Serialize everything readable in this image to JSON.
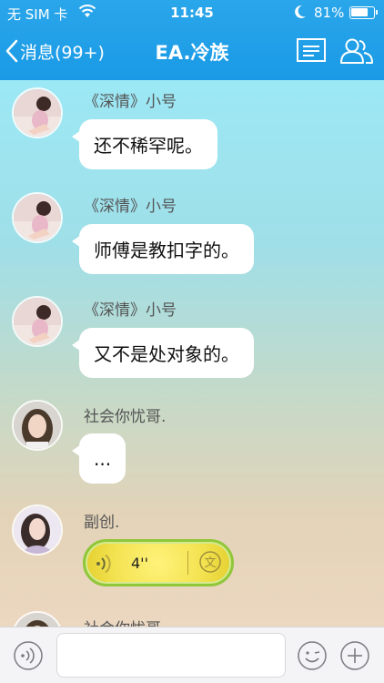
{
  "status_bar": {
    "carrier": "无 SIM 卡",
    "time": "11:45",
    "battery": "81%",
    "battery_level": 0.81
  },
  "nav": {
    "back_label": "消息(99+)",
    "title": "EA.冷族"
  },
  "messages": [
    {
      "sender": "《深情》小号",
      "text": "还不稀罕呢。"
    },
    {
      "sender": "《深情》小号",
      "text": "师傅是教扣字的。"
    },
    {
      "sender": "《深情》小号",
      "text": "又不是处对象的。"
    },
    {
      "sender": "社会你忧哥.",
      "text": "..."
    },
    {
      "sender": "副创.",
      "type": "voice",
      "duration": "4''",
      "convert_label": "文"
    },
    {
      "sender": "社会你忧哥."
    }
  ],
  "input": {
    "value": "",
    "placeholder": ""
  },
  "colors": {
    "header": "#1a9ae6",
    "voice_bubble": "#f3e250",
    "voice_border": "#8fc73a"
  }
}
